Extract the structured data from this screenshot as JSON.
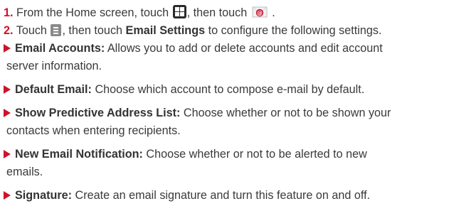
{
  "steps": [
    {
      "num": "1.",
      "text_a": "From the Home screen, touch",
      "text_b": ", then touch",
      "text_c": "."
    },
    {
      "num": "2.",
      "text_a": "Touch",
      "text_b": ", then touch",
      "bold": "Email Settings",
      "text_c": "to configure the following settings."
    }
  ],
  "icons": {
    "apps": "apps-grid-icon",
    "email": "email-app-icon",
    "menu": "menu-key-icon"
  },
  "bullets": [
    {
      "title": "Email Accounts:",
      "line1": "Allows you to add or delete accounts and edit account",
      "line2": "server information."
    },
    {
      "title": "Default Email:",
      "line1": "Choose which account to compose e-mail by default."
    },
    {
      "title": "Show Predictive Address List:",
      "line1": "Choose whether or not to be shown your",
      "line2": "contacts when entering recipients."
    },
    {
      "title": "New Email Notification:",
      "line1": "Choose whether or not to be alerted to new",
      "line2": "emails."
    },
    {
      "title": "Signature:",
      "line1": "Create an email signature and turn this feature on and off."
    }
  ],
  "colors": {
    "accent": "#d0112b",
    "text": "#3a3a3a"
  }
}
